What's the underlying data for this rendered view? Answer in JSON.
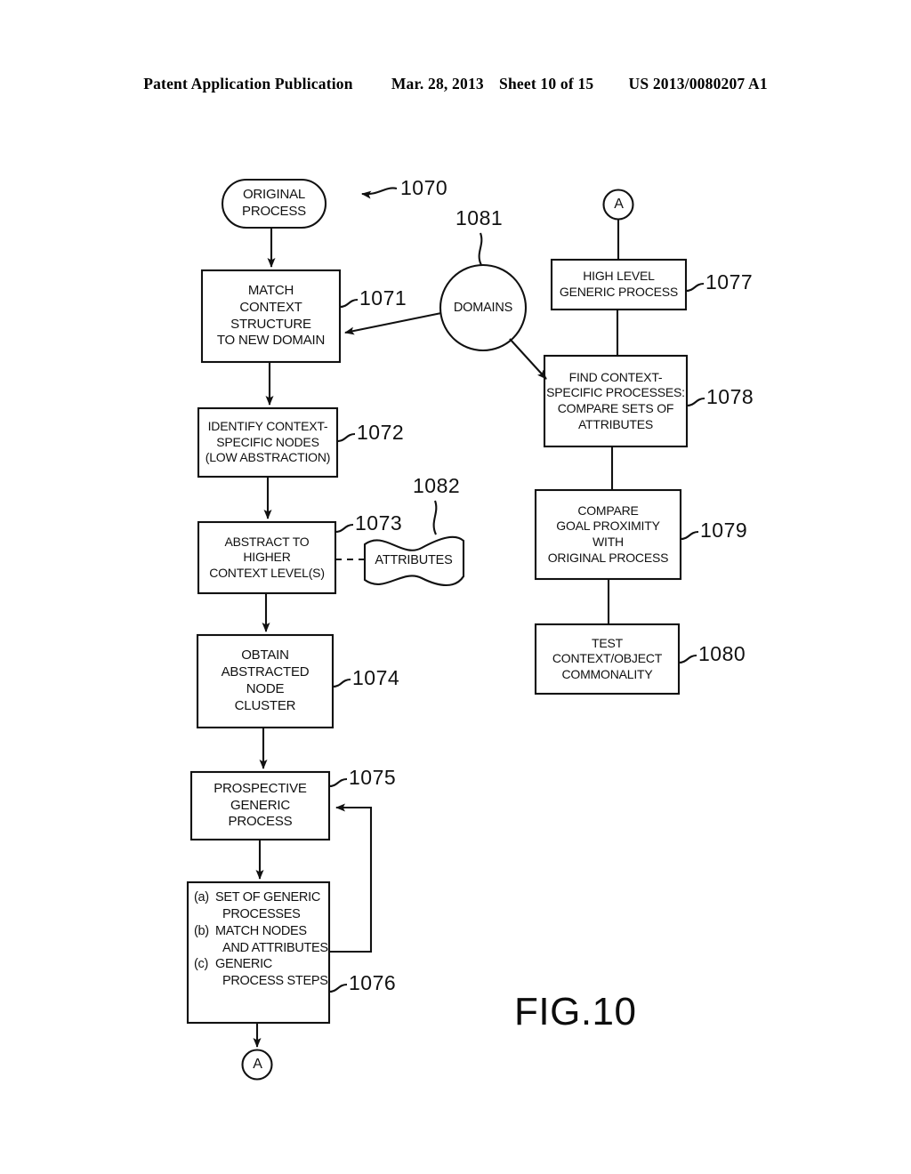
{
  "header": {
    "publication": "Patent Application Publication",
    "date": "Mar. 28, 2013",
    "sheet": "Sheet 10 of 15",
    "patent_number": "US 2013/0080207 A1"
  },
  "figure": {
    "caption": "FIG.10",
    "connector_top_right": "A",
    "connector_bottom_left": "A",
    "nodes": {
      "original_process": "ORIGINAL\nPROCESS",
      "match_context": "MATCH\nCONTEXT\nSTRUCTURE\nTO NEW DOMAIN",
      "identify_nodes": "IDENTIFY CONTEXT-\nSPECIFIC NODES\n(LOW ABSTRACTION)",
      "abstract_higher": "ABSTRACT TO\nHIGHER\nCONTEXT LEVEL(S)",
      "obtain_cluster": "OBTAIN\nABSTRACTED\nNODE\nCLUSTER",
      "prospective_generic": "PROSPECTIVE\nGENERIC\nPROCESS",
      "generic_list": [
        {
          "marker": "(a)",
          "text": "SET OF GENERIC",
          "cont": "PROCESSES"
        },
        {
          "marker": "(b)",
          "text": "MATCH NODES",
          "cont": "AND ATTRIBUTES"
        },
        {
          "marker": "(c)",
          "text": "GENERIC",
          "cont": "PROCESS STEPS"
        }
      ],
      "domains": "DOMAINS",
      "attributes": "ATTRIBUTES",
      "high_level_generic": "HIGH LEVEL\nGENERIC PROCESS",
      "find_context_specific": "FIND CONTEXT-\nSPECIFIC PROCESSES:\nCOMPARE SETS OF\nATTRIBUTES",
      "compare_goal": "COMPARE\nGOAL PROXIMITY\nWITH\nORIGINAL PROCESS",
      "test_commonality": "TEST\nCONTEXT/OBJECT\nCOMMONALITY"
    },
    "reference_numerals": {
      "diagram": "1070",
      "match_context": "1071",
      "identify_nodes": "1072",
      "abstract_higher": "1073",
      "obtain_cluster": "1074",
      "prospective_generic": "1075",
      "generic_list": "1076",
      "high_level_generic": "1077",
      "find_context_specific": "1078",
      "compare_goal": "1079",
      "test_commonality": "1080",
      "domains": "1081",
      "attributes": "1082"
    }
  },
  "colors": {
    "ink": "#111111",
    "paper": "#ffffff"
  }
}
